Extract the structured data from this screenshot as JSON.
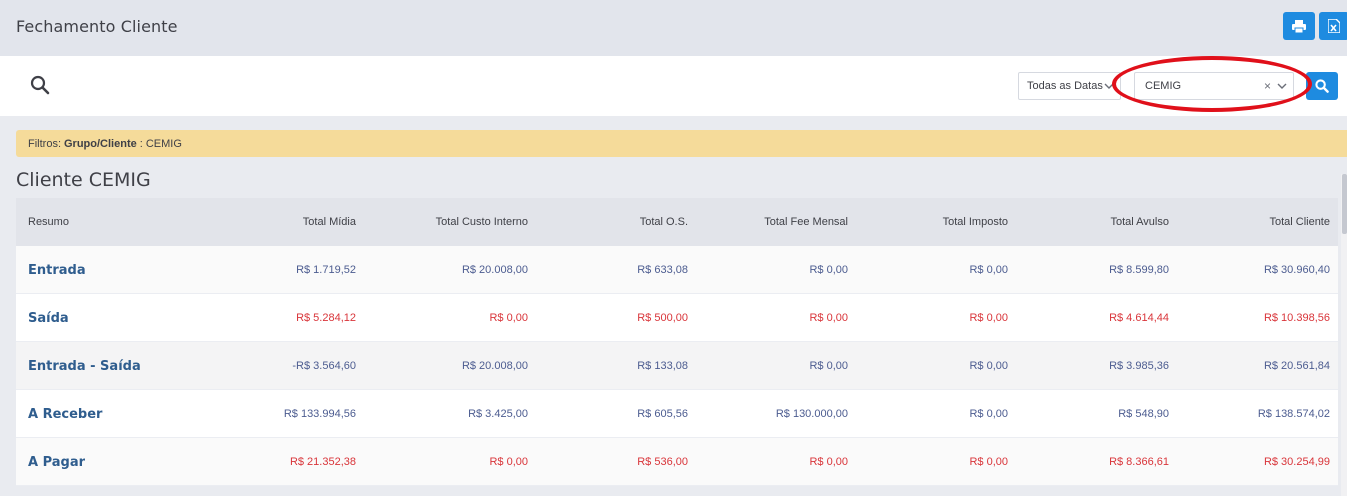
{
  "header": {
    "title": "Fechamento Cliente",
    "print_icon": "print-icon",
    "excel_icon": "excel-icon"
  },
  "search": {
    "icon": "search-icon",
    "date_filter": "Todas as Datas",
    "client_filter": "CEMIG",
    "clear_symbol": "×"
  },
  "filters": {
    "prefix": "Filtros:",
    "label": "Grupo/Cliente",
    "value": ": CEMIG"
  },
  "section": {
    "title": "Cliente CEMIG"
  },
  "colors": {
    "accent": "#1e8be0",
    "positive": "#4c5c90",
    "negative": "#d9353a",
    "highlight": "#e0101a",
    "filter_bg": "#f5db9a"
  },
  "table": {
    "headers": [
      "Resumo",
      "Total Mídia",
      "Total Custo Interno",
      "Total O.S.",
      "Total Fee Mensal",
      "Total Imposto",
      "Total Avulso",
      "Total Cliente"
    ],
    "rows": [
      {
        "label": "Entrada",
        "tone": "pos",
        "values": [
          "R$ 1.719,52",
          "R$ 20.008,00",
          "R$ 633,08",
          "R$ 0,00",
          "R$ 0,00",
          "R$ 8.599,80",
          "R$ 30.960,40"
        ]
      },
      {
        "label": "Saída",
        "tone": "neg",
        "values": [
          "R$ 5.284,12",
          "R$ 0,00",
          "R$ 500,00",
          "R$ 0,00",
          "R$ 0,00",
          "R$ 4.614,44",
          "R$ 10.398,56"
        ]
      },
      {
        "label": "Entrada - Saída",
        "tone": "pos",
        "values": [
          "-R$ 3.564,60",
          "R$ 20.008,00",
          "R$ 133,08",
          "R$ 0,00",
          "R$ 0,00",
          "R$ 3.985,36",
          "R$ 20.561,84"
        ]
      },
      {
        "label": "A Receber",
        "tone": "pos",
        "values": [
          "R$ 133.994,56",
          "R$ 3.425,00",
          "R$ 605,56",
          "R$ 130.000,00",
          "R$ 0,00",
          "R$ 548,90",
          "R$ 138.574,02"
        ]
      },
      {
        "label": "A Pagar",
        "tone": "neg",
        "values": [
          "R$ 21.352,38",
          "R$ 0,00",
          "R$ 536,00",
          "R$ 0,00",
          "R$ 0,00",
          "R$ 8.366,61",
          "R$ 30.254,99"
        ]
      }
    ]
  }
}
